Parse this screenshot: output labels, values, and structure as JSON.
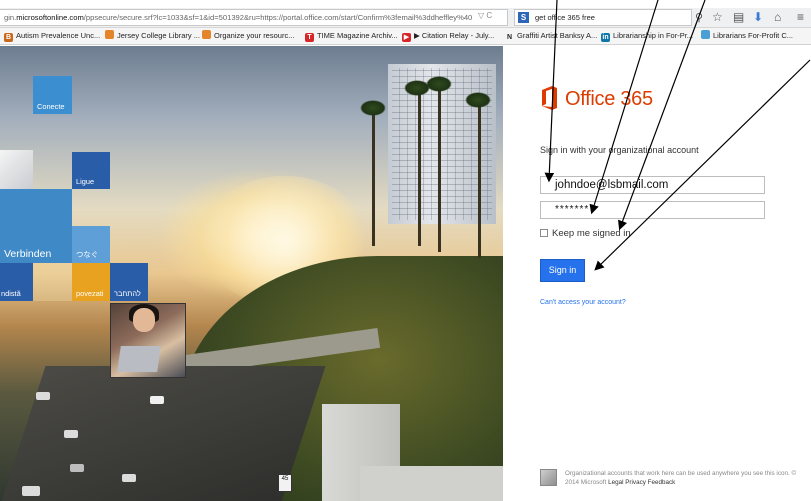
{
  "browser": {
    "url_prefix": "gin.",
    "url_domain": "microsoftonline.com",
    "url_rest": "/ppsecure/secure.srf?lc=1033&sf=1&id=501392&ru=https://portal.office.com/start/Confirm%3femail%3ddheffley%40",
    "url_tools": "▽ C",
    "search_engine_glyph": "S",
    "search_query": "get office 365 free",
    "search_icon": "magnifier-icon",
    "toolbar_icons": [
      "star-icon",
      "reading-list-icon",
      "download-icon",
      "home-icon",
      "menu-icon"
    ]
  },
  "bookmarks": [
    {
      "icon": "B",
      "icon_color": "#c8681c",
      "label": "Autism Prevalence Unc..."
    },
    {
      "icon": "",
      "icon_color": "#e4852b",
      "label": "Jersey College Library ..."
    },
    {
      "icon": "",
      "icon_color": "#e4852b",
      "label": "Organize your resourc..."
    },
    {
      "icon": "T",
      "icon_color": "#d6262a",
      "label": "TIME Magazine Archiv..."
    },
    {
      "icon": "▶",
      "icon_color": "#d6262a",
      "label": "▶ Citation Relay - July..."
    },
    {
      "icon": "N",
      "icon_color": "#ffffff",
      "label": "Graffiti Artist Banksy A..."
    },
    {
      "icon": "in",
      "icon_color": "#0e76a8",
      "label": "Librarianship in For-Pr..."
    },
    {
      "icon": "",
      "icon_color": "#4aa0d5",
      "label": "Librarians For-Profit C..."
    }
  ],
  "tiles": [
    {
      "label": "Conecte",
      "color": "#3b8fd0"
    },
    {
      "label": "Ligue",
      "color": "#2a5da8"
    },
    {
      "label": "Verbinden",
      "color": "#3f8ac6"
    },
    {
      "label": "つなぐ",
      "color": "#5e9fd8"
    },
    {
      "label": "ndistă",
      "color": "#2a5da8"
    },
    {
      "label": "povezati",
      "color": "#e8a21f"
    },
    {
      "label": "להתחבר",
      "color": "#2a5da8"
    }
  ],
  "hero": {
    "highway_sign": "45"
  },
  "signin": {
    "brand": "Office 365",
    "brand_color": "#dc3c00",
    "heading": "Sign in with your organizational account",
    "username_value": "johndoe@lsbmail.com",
    "password_value": "*******",
    "keep_signed_in_label": "Keep me signed in",
    "keep_signed_in_checked": false,
    "button_label": "Sign in",
    "button_color": "#2672ec",
    "cant_access_link": "Can't access your account?"
  },
  "footer": {
    "text": "Organizational accounts that work here can be used anywhere you see this icon. © 2014 Microsoft",
    "links": [
      "Legal",
      "Privacy",
      "Feedback"
    ]
  }
}
